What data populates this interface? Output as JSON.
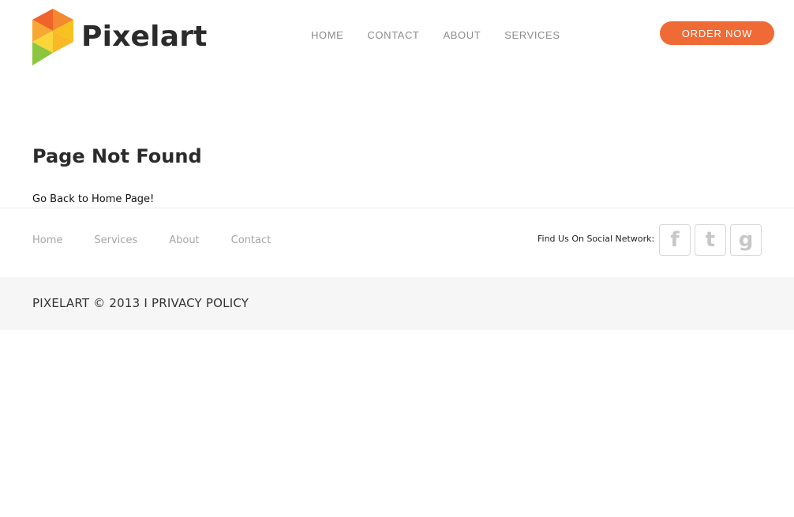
{
  "header": {
    "logo_text": "Pixelart",
    "nav": [
      "HOME",
      "CONTACT",
      "ABOUT",
      "SERVICES"
    ],
    "order_button": "ORDER NOW"
  },
  "main": {
    "title": "Page Not Found",
    "back_link": "Go Back to Home Page!"
  },
  "footer": {
    "nav": [
      "Home",
      "Services",
      "About",
      "Contact"
    ],
    "social_label": "Find Us On Social Network:",
    "social_icons": [
      "facebook-icon",
      "twitter-icon",
      "google-plus-icon"
    ],
    "copyright": "PIXELART © 2013 I PRIVACY POLICY"
  },
  "colors": {
    "accent": "#f06a36",
    "logo_orange": "#f47c2e",
    "logo_yellow": "#f8c21e",
    "logo_green": "#8cc63f",
    "text_dark": "#2b2b2b",
    "nav_gray": "#8c8c8c",
    "footer_bg": "#f6f6f6"
  }
}
